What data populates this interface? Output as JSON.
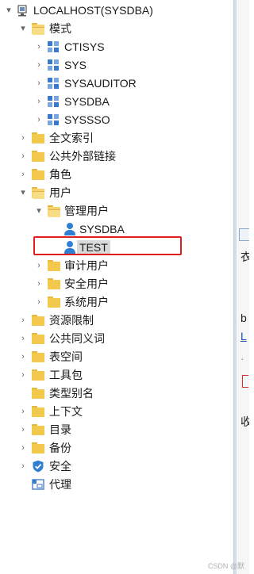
{
  "tree": {
    "items": [
      {
        "label": "LOCALHOST(SYSDBA)",
        "icon": "server-icon",
        "expander": "▾"
      },
      {
        "label": "模式",
        "icon": "folder-open-icon",
        "expander": "▾"
      },
      {
        "label": "CTISYS",
        "icon": "schema-icon",
        "expander": "›"
      },
      {
        "label": "SYS",
        "icon": "schema-icon",
        "expander": "›"
      },
      {
        "label": "SYSAUDITOR",
        "icon": "schema-icon",
        "expander": "›"
      },
      {
        "label": "SYSDBA",
        "icon": "schema-icon",
        "expander": "›"
      },
      {
        "label": "SYSSSO",
        "icon": "schema-icon",
        "expander": "›"
      },
      {
        "label": "全文索引",
        "icon": "folder-icon",
        "expander": "›"
      },
      {
        "label": "公共外部链接",
        "icon": "folder-icon",
        "expander": "›"
      },
      {
        "label": "角色",
        "icon": "folder-icon",
        "expander": "›"
      },
      {
        "label": "用户",
        "icon": "folder-open-icon",
        "expander": "▾"
      },
      {
        "label": "管理用户",
        "icon": "folder-open-icon",
        "expander": "▾"
      },
      {
        "label": "SYSDBA",
        "icon": "user-icon",
        "expander": ""
      },
      {
        "label": "TEST",
        "icon": "user-icon",
        "expander": "",
        "selected": true
      },
      {
        "label": "审计用户",
        "icon": "folder-icon",
        "expander": "›"
      },
      {
        "label": "安全用户",
        "icon": "folder-icon",
        "expander": "›"
      },
      {
        "label": "系统用户",
        "icon": "folder-icon",
        "expander": "›"
      },
      {
        "label": "资源限制",
        "icon": "folder-icon",
        "expander": "›"
      },
      {
        "label": "公共同义词",
        "icon": "folder-icon",
        "expander": "›"
      },
      {
        "label": "表空间",
        "icon": "folder-icon",
        "expander": "›"
      },
      {
        "label": "工具包",
        "icon": "folder-icon",
        "expander": "›"
      },
      {
        "label": "类型别名",
        "icon": "folder-icon",
        "expander": ""
      },
      {
        "label": "上下文",
        "icon": "folder-icon",
        "expander": "›"
      },
      {
        "label": "目录",
        "icon": "folder-icon",
        "expander": "›"
      },
      {
        "label": "备份",
        "icon": "folder-icon",
        "expander": "›"
      },
      {
        "label": "安全",
        "icon": "shield-icon",
        "expander": "›"
      },
      {
        "label": "代理",
        "icon": "proxy-icon",
        "expander": ""
      }
    ]
  },
  "right_pane": {
    "fragments": [
      "衣",
      "b",
      "L",
      "·",
      "[",
      "收"
    ]
  },
  "watermark": "CSDN @默",
  "colors": {
    "highlight": "#e01e1e",
    "folder": "#f2c94c",
    "user": "#2f7fd2",
    "schema": "#3a78c9"
  }
}
